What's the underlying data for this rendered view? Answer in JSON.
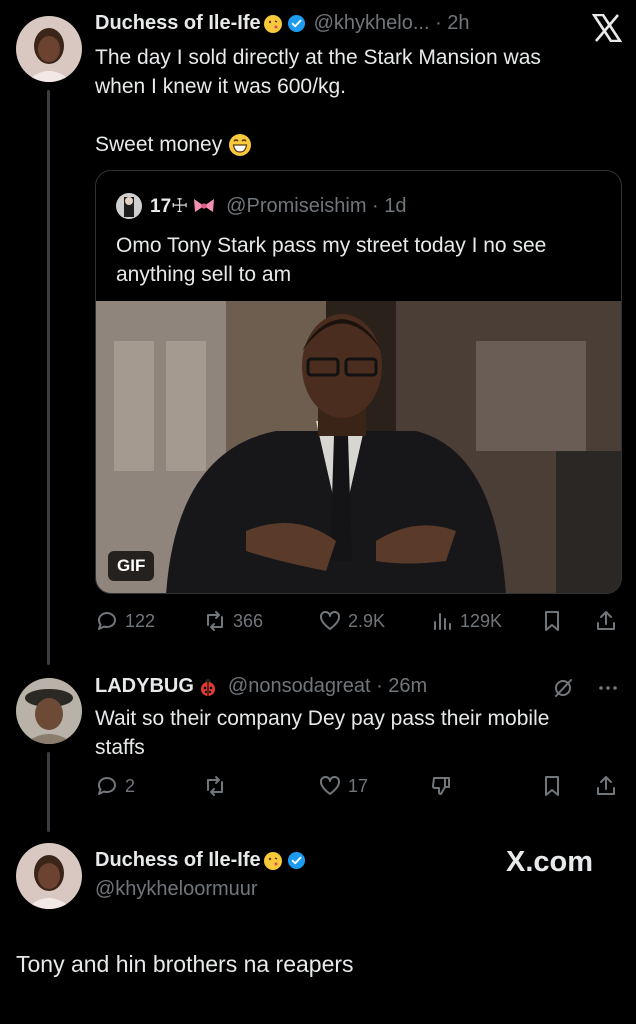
{
  "tweet": {
    "display_name": "Duchess of Ile-Ife",
    "handle_time": "@khykhelo... · 2h",
    "text_line1": "The day I sold directly at the Stark Mansion was",
    "text_line2": "when I knew it was 600/kg.",
    "text_line3": "Sweet money",
    "quote": {
      "name": "17☩",
      "handle_time": "@Promiseishim · 1d",
      "text_line1": "Omo Tony Stark pass my street today I no see",
      "text_line2": "anything sell to am",
      "gif_label": "GIF"
    },
    "actions": {
      "replies": "122",
      "reposts": "366",
      "likes": "2.9K",
      "views": "129K"
    }
  },
  "reply": {
    "display_name": "LADYBUG",
    "handle_time": "@nonsodagreat · 26m",
    "text_line1": "Wait so their company Dey pay pass their mobile",
    "text_line2": "staffs",
    "actions": {
      "replies": "2",
      "likes": "17"
    }
  },
  "footer": {
    "display_name": "Duchess of Ile-Ife",
    "handle": "@khykheloormuur",
    "brand": "X.com",
    "caption": "Tony and hin brothers na reapers"
  },
  "colors": {
    "background": "#000000",
    "text": "#e7e9ea",
    "muted": "#71767b",
    "verified": "#1d9bf0",
    "border": "#2f3336"
  }
}
